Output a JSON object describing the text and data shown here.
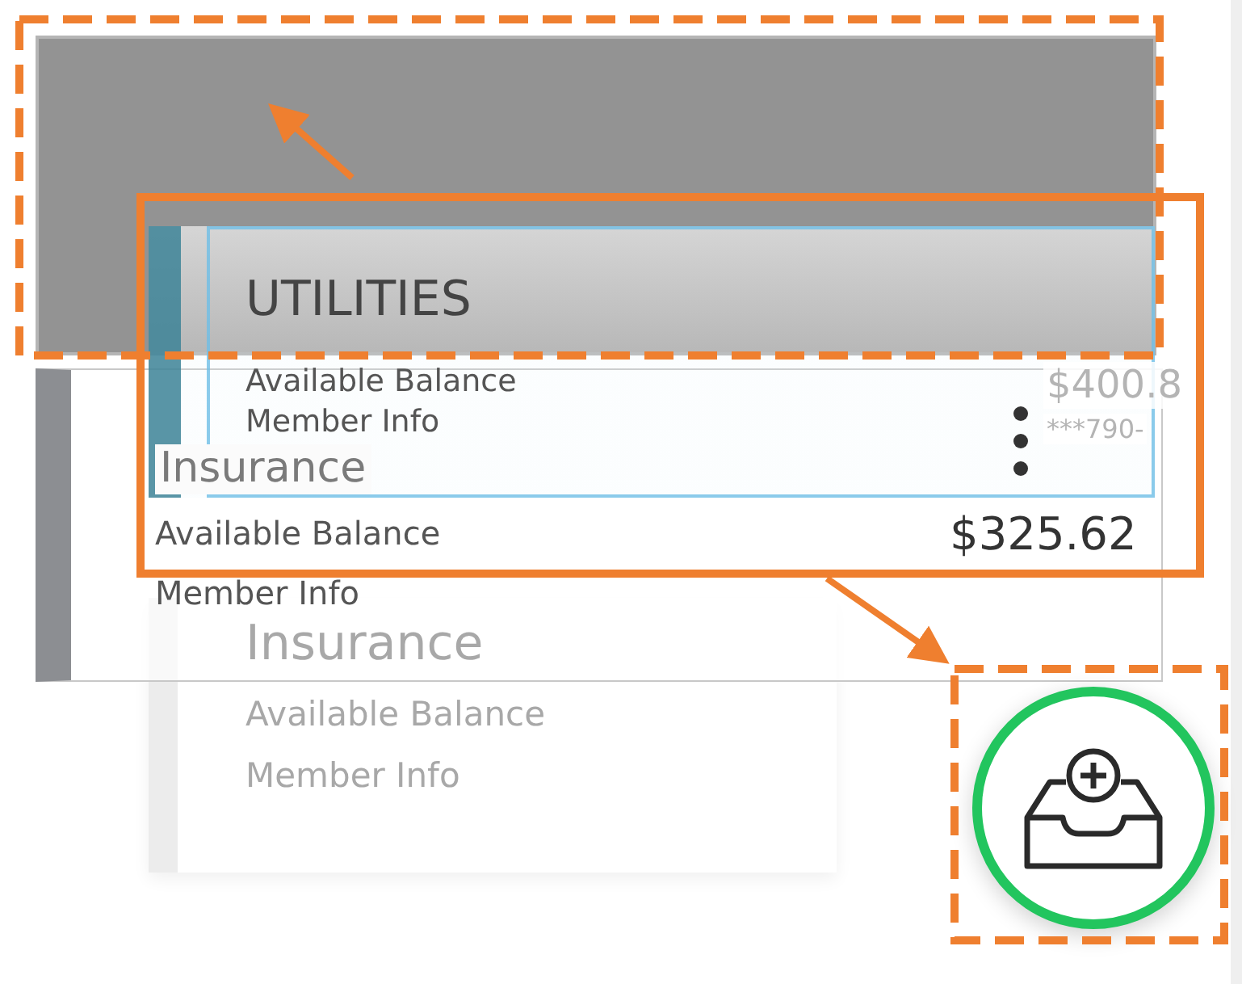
{
  "background_card": {
    "amount": "$400.8",
    "account": "***790-"
  },
  "faded_card": {
    "title": "Insurance",
    "balance_label": "Available Balance",
    "member_label": "Member Info"
  },
  "insurance_card": {
    "title": "Insurance",
    "balance_label": "Available Balance",
    "member_label": "Member Info",
    "amount": "$325.62"
  },
  "utilities_card": {
    "title": "UTILITIES",
    "balance_label": "Available Balance",
    "member_label": "Member Info"
  }
}
